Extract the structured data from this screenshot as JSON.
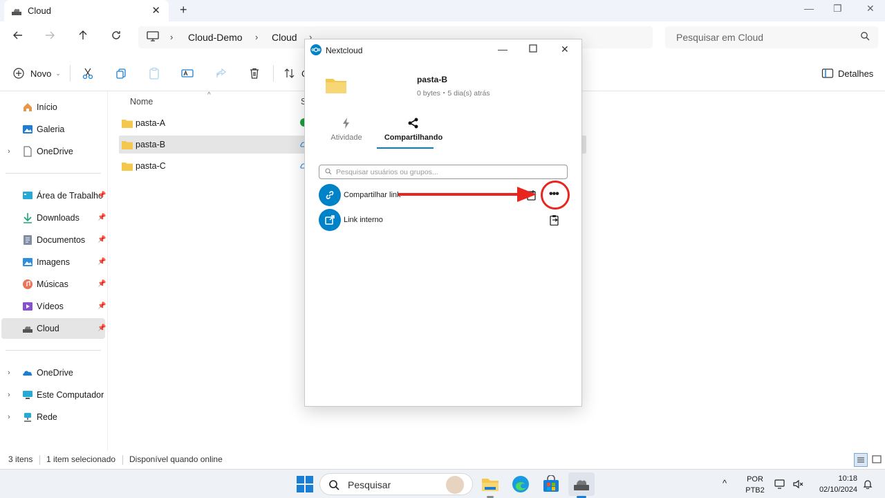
{
  "window": {
    "tab_title": "Cloud",
    "new_tab": "+",
    "close_tab": "✕",
    "minimize": "—",
    "maximize": "❐",
    "close": "✕"
  },
  "address": {
    "crumbs": [
      "Cloud-Demo",
      "Cloud"
    ],
    "search_placeholder": "Pesquisar em Cloud"
  },
  "commands": {
    "new_label": "Novo",
    "sort_label": "C",
    "details_label": "Detalhes"
  },
  "sidebar": {
    "items": [
      {
        "label": "Início",
        "icon": "home-icon"
      },
      {
        "label": "Galeria",
        "icon": "gallery-icon"
      },
      {
        "label": "OneDrive",
        "icon": "document-icon"
      },
      {
        "label": "Área de Trabalho",
        "icon": "desktop-icon"
      },
      {
        "label": "Downloads",
        "icon": "download-icon"
      },
      {
        "label": "Documentos",
        "icon": "documents-icon"
      },
      {
        "label": "Imagens",
        "icon": "pictures-icon"
      },
      {
        "label": "Músicas",
        "icon": "music-icon"
      },
      {
        "label": "Vídeos",
        "icon": "videos-icon"
      },
      {
        "label": "Cloud",
        "icon": "cloud-drive-icon"
      },
      {
        "label": "OneDrive",
        "icon": "onedrive-icon"
      },
      {
        "label": "Este Computador",
        "icon": "computer-icon"
      },
      {
        "label": "Rede",
        "icon": "network-icon"
      }
    ]
  },
  "filelist": {
    "col_name": "Nome",
    "col_status": "S",
    "files": [
      {
        "name": "pasta-A",
        "status": "synced"
      },
      {
        "name": "pasta-B",
        "status": "online-only"
      },
      {
        "name": "pasta-C",
        "status": "online-only"
      }
    ]
  },
  "statusbar": {
    "count": "3 itens",
    "selected": "1 item selecionado",
    "availability": "Disponível quando online"
  },
  "nextcloud": {
    "title": "Nextcloud",
    "folder_name": "pasta-B",
    "folder_meta": "0 bytes・5 dia(s) atrás",
    "tab_activity": "Atividade",
    "tab_sharing": "Compartilhando",
    "search_placeholder": "Pesquisar usuários ou grupos...",
    "share_link_label": "Compartilhar link",
    "internal_link_label": "Link interno",
    "more_label": "•••"
  },
  "colors": {
    "accent": "#0082c9",
    "annotation": "#e8251f",
    "folder": "#f4c84f"
  },
  "taskbar": {
    "search_placeholder": "Pesquisar",
    "lang_top": "POR",
    "lang_bottom": "PTB2",
    "time": "10:18",
    "date": "02/10/2024"
  }
}
